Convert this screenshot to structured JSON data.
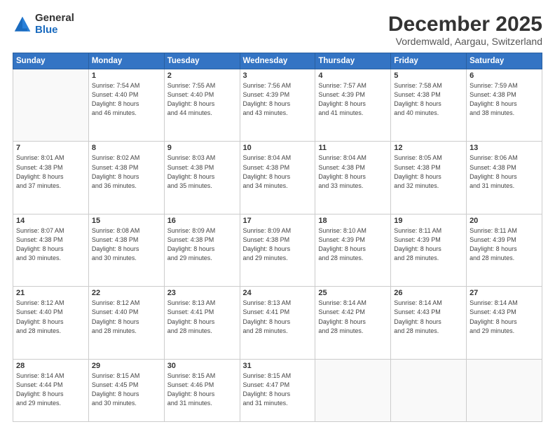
{
  "logo": {
    "general": "General",
    "blue": "Blue"
  },
  "header": {
    "month": "December 2025",
    "location": "Vordemwald, Aargau, Switzerland"
  },
  "days_of_week": [
    "Sunday",
    "Monday",
    "Tuesday",
    "Wednesday",
    "Thursday",
    "Friday",
    "Saturday"
  ],
  "weeks": [
    [
      {
        "day": "",
        "info": ""
      },
      {
        "day": "1",
        "info": "Sunrise: 7:54 AM\nSunset: 4:40 PM\nDaylight: 8 hours\nand 46 minutes."
      },
      {
        "day": "2",
        "info": "Sunrise: 7:55 AM\nSunset: 4:40 PM\nDaylight: 8 hours\nand 44 minutes."
      },
      {
        "day": "3",
        "info": "Sunrise: 7:56 AM\nSunset: 4:39 PM\nDaylight: 8 hours\nand 43 minutes."
      },
      {
        "day": "4",
        "info": "Sunrise: 7:57 AM\nSunset: 4:39 PM\nDaylight: 8 hours\nand 41 minutes."
      },
      {
        "day": "5",
        "info": "Sunrise: 7:58 AM\nSunset: 4:38 PM\nDaylight: 8 hours\nand 40 minutes."
      },
      {
        "day": "6",
        "info": "Sunrise: 7:59 AM\nSunset: 4:38 PM\nDaylight: 8 hours\nand 38 minutes."
      }
    ],
    [
      {
        "day": "7",
        "info": "Sunrise: 8:01 AM\nSunset: 4:38 PM\nDaylight: 8 hours\nand 37 minutes."
      },
      {
        "day": "8",
        "info": "Sunrise: 8:02 AM\nSunset: 4:38 PM\nDaylight: 8 hours\nand 36 minutes."
      },
      {
        "day": "9",
        "info": "Sunrise: 8:03 AM\nSunset: 4:38 PM\nDaylight: 8 hours\nand 35 minutes."
      },
      {
        "day": "10",
        "info": "Sunrise: 8:04 AM\nSunset: 4:38 PM\nDaylight: 8 hours\nand 34 minutes."
      },
      {
        "day": "11",
        "info": "Sunrise: 8:04 AM\nSunset: 4:38 PM\nDaylight: 8 hours\nand 33 minutes."
      },
      {
        "day": "12",
        "info": "Sunrise: 8:05 AM\nSunset: 4:38 PM\nDaylight: 8 hours\nand 32 minutes."
      },
      {
        "day": "13",
        "info": "Sunrise: 8:06 AM\nSunset: 4:38 PM\nDaylight: 8 hours\nand 31 minutes."
      }
    ],
    [
      {
        "day": "14",
        "info": "Sunrise: 8:07 AM\nSunset: 4:38 PM\nDaylight: 8 hours\nand 30 minutes."
      },
      {
        "day": "15",
        "info": "Sunrise: 8:08 AM\nSunset: 4:38 PM\nDaylight: 8 hours\nand 30 minutes."
      },
      {
        "day": "16",
        "info": "Sunrise: 8:09 AM\nSunset: 4:38 PM\nDaylight: 8 hours\nand 29 minutes."
      },
      {
        "day": "17",
        "info": "Sunrise: 8:09 AM\nSunset: 4:38 PM\nDaylight: 8 hours\nand 29 minutes."
      },
      {
        "day": "18",
        "info": "Sunrise: 8:10 AM\nSunset: 4:39 PM\nDaylight: 8 hours\nand 28 minutes."
      },
      {
        "day": "19",
        "info": "Sunrise: 8:11 AM\nSunset: 4:39 PM\nDaylight: 8 hours\nand 28 minutes."
      },
      {
        "day": "20",
        "info": "Sunrise: 8:11 AM\nSunset: 4:39 PM\nDaylight: 8 hours\nand 28 minutes."
      }
    ],
    [
      {
        "day": "21",
        "info": "Sunrise: 8:12 AM\nSunset: 4:40 PM\nDaylight: 8 hours\nand 28 minutes."
      },
      {
        "day": "22",
        "info": "Sunrise: 8:12 AM\nSunset: 4:40 PM\nDaylight: 8 hours\nand 28 minutes."
      },
      {
        "day": "23",
        "info": "Sunrise: 8:13 AM\nSunset: 4:41 PM\nDaylight: 8 hours\nand 28 minutes."
      },
      {
        "day": "24",
        "info": "Sunrise: 8:13 AM\nSunset: 4:41 PM\nDaylight: 8 hours\nand 28 minutes."
      },
      {
        "day": "25",
        "info": "Sunrise: 8:14 AM\nSunset: 4:42 PM\nDaylight: 8 hours\nand 28 minutes."
      },
      {
        "day": "26",
        "info": "Sunrise: 8:14 AM\nSunset: 4:43 PM\nDaylight: 8 hours\nand 28 minutes."
      },
      {
        "day": "27",
        "info": "Sunrise: 8:14 AM\nSunset: 4:43 PM\nDaylight: 8 hours\nand 29 minutes."
      }
    ],
    [
      {
        "day": "28",
        "info": "Sunrise: 8:14 AM\nSunset: 4:44 PM\nDaylight: 8 hours\nand 29 minutes."
      },
      {
        "day": "29",
        "info": "Sunrise: 8:15 AM\nSunset: 4:45 PM\nDaylight: 8 hours\nand 30 minutes."
      },
      {
        "day": "30",
        "info": "Sunrise: 8:15 AM\nSunset: 4:46 PM\nDaylight: 8 hours\nand 31 minutes."
      },
      {
        "day": "31",
        "info": "Sunrise: 8:15 AM\nSunset: 4:47 PM\nDaylight: 8 hours\nand 31 minutes."
      },
      {
        "day": "",
        "info": ""
      },
      {
        "day": "",
        "info": ""
      },
      {
        "day": "",
        "info": ""
      }
    ]
  ]
}
